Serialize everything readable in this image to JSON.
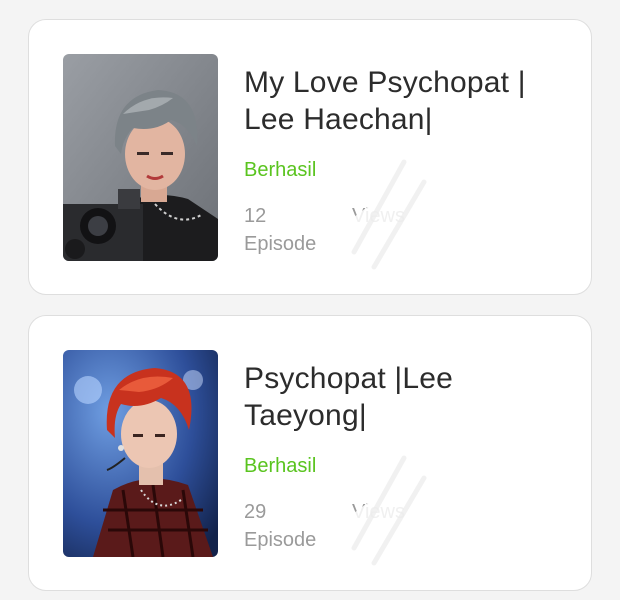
{
  "stories": [
    {
      "title_line1": "My Love Psychopat |",
      "title_line2": "Lee Haechan|",
      "status": "Berhasil",
      "episodes": "12",
      "episodes_label": "Episode",
      "views": "",
      "views_label": "Views",
      "cover_image": "boy-with-grey-hair-and-camera"
    },
    {
      "title_line1": "Psychopat |Lee",
      "title_line2": "Taeyong|",
      "status": "Berhasil",
      "episodes": "29",
      "episodes_label": "Episode",
      "views": "",
      "views_label": "Views",
      "cover_image": "boy-with-red-hair-on-stage"
    }
  ],
  "colors": {
    "status_green": "#5ac41f",
    "title": "#2c2c2c",
    "muted": "#9a9a9a",
    "card_border": "#dedede",
    "background": "#f4f4f4"
  }
}
